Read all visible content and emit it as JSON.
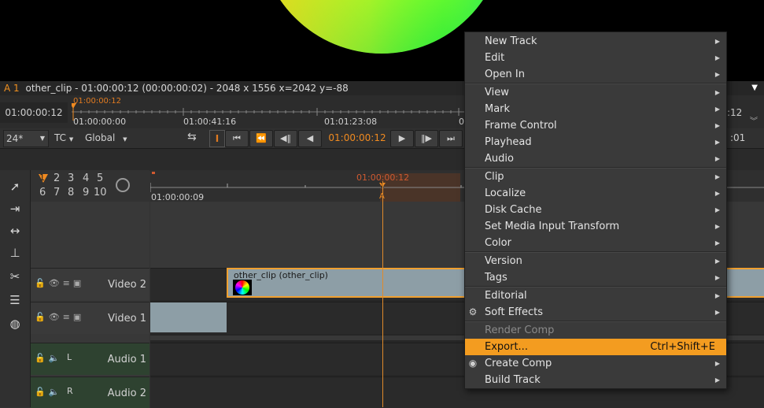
{
  "viewer": {
    "input_label": "A 1",
    "info_text": "other_clip - 01:00:00:12 (00:00:00:02) - 2048 x 1556   x=2042 y=-88"
  },
  "scrubber": {
    "current_tc": "01:00:00:12",
    "marker_tc": "01:00:00:12",
    "tick_labels": [
      "01:00:00:00",
      "01:00:41:16",
      "01:01:23:08",
      "0"
    ],
    "right_tc": ":12"
  },
  "controls": {
    "fps": "24*",
    "tc_mode": "TC",
    "scope": "Global",
    "timecode": "01:00:00:12",
    "right_tc": ":01"
  },
  "timeline": {
    "tool_numbers": [
      "1",
      "2",
      "3",
      "4",
      "5",
      "6",
      "7",
      "8",
      "9",
      "10"
    ],
    "ruler_start": "01:00:00:09",
    "ruler_marker_tc": "01:00:00:12",
    "playhead_label": "A",
    "playhead_number": "1",
    "tracks": [
      {
        "name": "Video 2",
        "kind": "video"
      },
      {
        "name": "Video 1",
        "kind": "video"
      },
      {
        "name": "Audio 1",
        "kind": "audio",
        "channel": "L"
      },
      {
        "name": "Audio 2",
        "kind": "audio",
        "channel": "R"
      }
    ],
    "clip_label": "other_clip (other_clip)"
  },
  "context_menu": {
    "items": [
      {
        "label": "New Track",
        "submenu": true
      },
      {
        "label": "Edit",
        "submenu": true
      },
      {
        "label": "Open In",
        "submenu": true
      },
      {
        "label": "View",
        "submenu": true
      },
      {
        "label": "Mark",
        "submenu": true
      },
      {
        "label": "Frame Control",
        "submenu": true
      },
      {
        "label": "Playhead",
        "submenu": true
      },
      {
        "label": "Audio",
        "submenu": true
      },
      {
        "label": "Clip",
        "submenu": true
      },
      {
        "label": "Localize",
        "submenu": true
      },
      {
        "label": "Disk Cache",
        "submenu": true
      },
      {
        "label": "Set Media Input Transform",
        "submenu": true
      },
      {
        "label": "Color",
        "submenu": true
      },
      {
        "label": "Version",
        "submenu": true
      },
      {
        "label": "Tags",
        "submenu": true
      },
      {
        "label": "Editorial",
        "submenu": true
      },
      {
        "label": "Soft Effects",
        "submenu": true,
        "icon": "soft-effects-icon"
      },
      {
        "label": "Render Comp",
        "disabled": true
      },
      {
        "label": "Export...",
        "shortcut": "Ctrl+Shift+E",
        "highlighted": true
      },
      {
        "label": "Create Comp",
        "submenu": true,
        "icon": "create-comp-icon"
      },
      {
        "label": "Build Track",
        "submenu": true
      }
    ]
  },
  "colors": {
    "accent": "#f39c20",
    "playhead": "#e08a2a",
    "clip": "#8d9ea6",
    "audio_header": "#2e4230"
  }
}
